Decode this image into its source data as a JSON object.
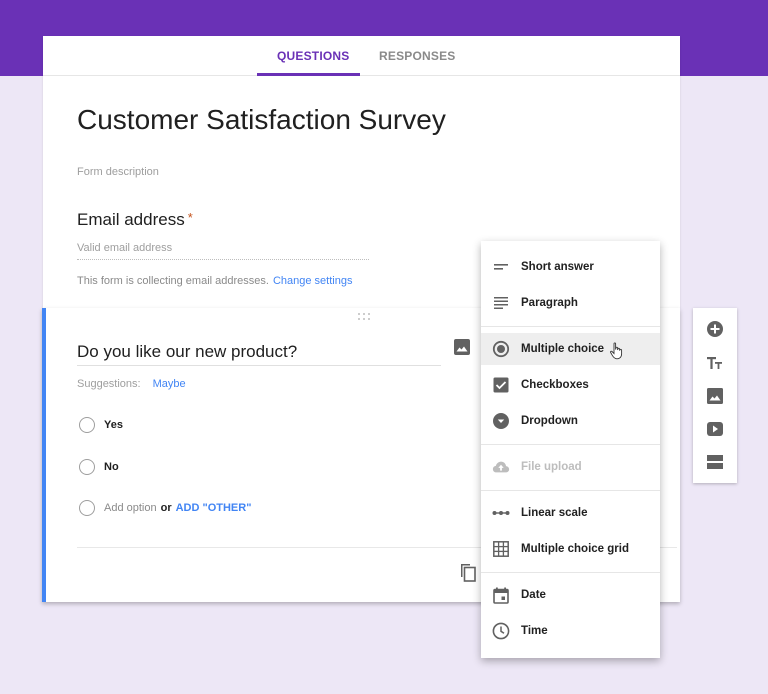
{
  "tabs": [
    {
      "label": "QUESTIONS",
      "active": true
    },
    {
      "label": "RESPONSES",
      "active": false
    }
  ],
  "form": {
    "title": "Customer Satisfaction Survey",
    "description_placeholder": "Form description",
    "email": {
      "label": "Email address",
      "required_mark": "*",
      "placeholder": "Valid email address",
      "note": "This form is collecting email addresses.",
      "change_settings": "Change settings"
    }
  },
  "question": {
    "title": "Do you like our new product?",
    "suggestions_label": "Suggestions:",
    "suggestion": "Maybe",
    "options": [
      "Yes",
      "No"
    ],
    "add_option": "Add option",
    "or": "or",
    "add_other": "ADD \"OTHER\""
  },
  "question_type_menu": {
    "selected": "Multiple choice",
    "groups": [
      [
        {
          "label": "Short answer",
          "icon": "short-answer-icon"
        },
        {
          "label": "Paragraph",
          "icon": "paragraph-icon"
        }
      ],
      [
        {
          "label": "Multiple choice",
          "icon": "radio-button-icon",
          "hover": true
        },
        {
          "label": "Checkboxes",
          "icon": "checkbox-icon"
        },
        {
          "label": "Dropdown",
          "icon": "dropdown-icon"
        }
      ],
      [
        {
          "label": "File upload",
          "icon": "cloud-upload-icon",
          "disabled": true
        }
      ],
      [
        {
          "label": "Linear scale",
          "icon": "linear-scale-icon"
        },
        {
          "label": "Multiple choice grid",
          "icon": "grid-icon"
        }
      ],
      [
        {
          "label": "Date",
          "icon": "calendar-icon"
        },
        {
          "label": "Time",
          "icon": "clock-icon"
        }
      ]
    ]
  },
  "side_toolbar": [
    {
      "name": "add-question",
      "icon": "add-circle-icon"
    },
    {
      "name": "add-title",
      "icon": "title-text-icon"
    },
    {
      "name": "add-image",
      "icon": "image-icon"
    },
    {
      "name": "add-video",
      "icon": "video-icon"
    },
    {
      "name": "add-section",
      "icon": "section-icon"
    }
  ],
  "colors": {
    "brand": "#6a31b6",
    "background": "#ede7f6",
    "accent_blue": "#4285f4",
    "required": "#c5531c"
  }
}
